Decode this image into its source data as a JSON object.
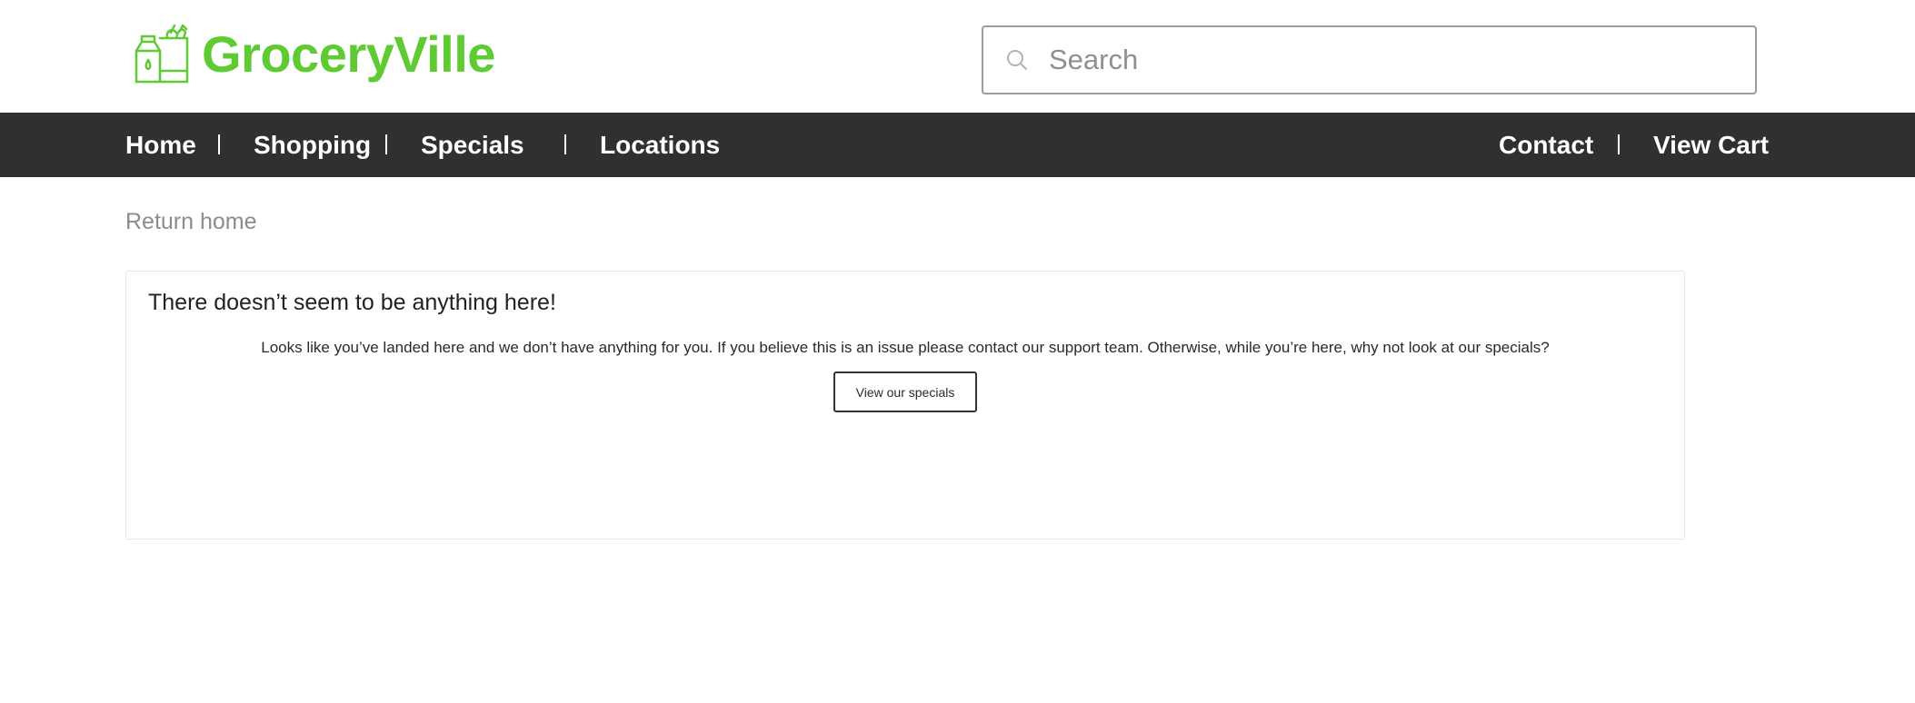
{
  "brand": {
    "name": "GroceryVille",
    "color": "#5ecb32"
  },
  "search": {
    "placeholder": "Search"
  },
  "nav": {
    "left_items": [
      "Home",
      "Shopping",
      "Specials",
      "Locations"
    ],
    "right_items": [
      "Contact",
      "View Cart"
    ],
    "background": "#303030"
  },
  "breadcrumb": {
    "return_label": "Return home"
  },
  "empty_state": {
    "title": "There doesn’t seem to be anything here!",
    "message": "Looks like you’ve landed here and we don’t have anything for you. If you believe this is an issue please contact our support team. Otherwise, while you’re here, why not look at our specials?",
    "button_label": "View our specials"
  },
  "icons": {
    "logo": "grocery-bag-icon",
    "search": "search-icon"
  }
}
